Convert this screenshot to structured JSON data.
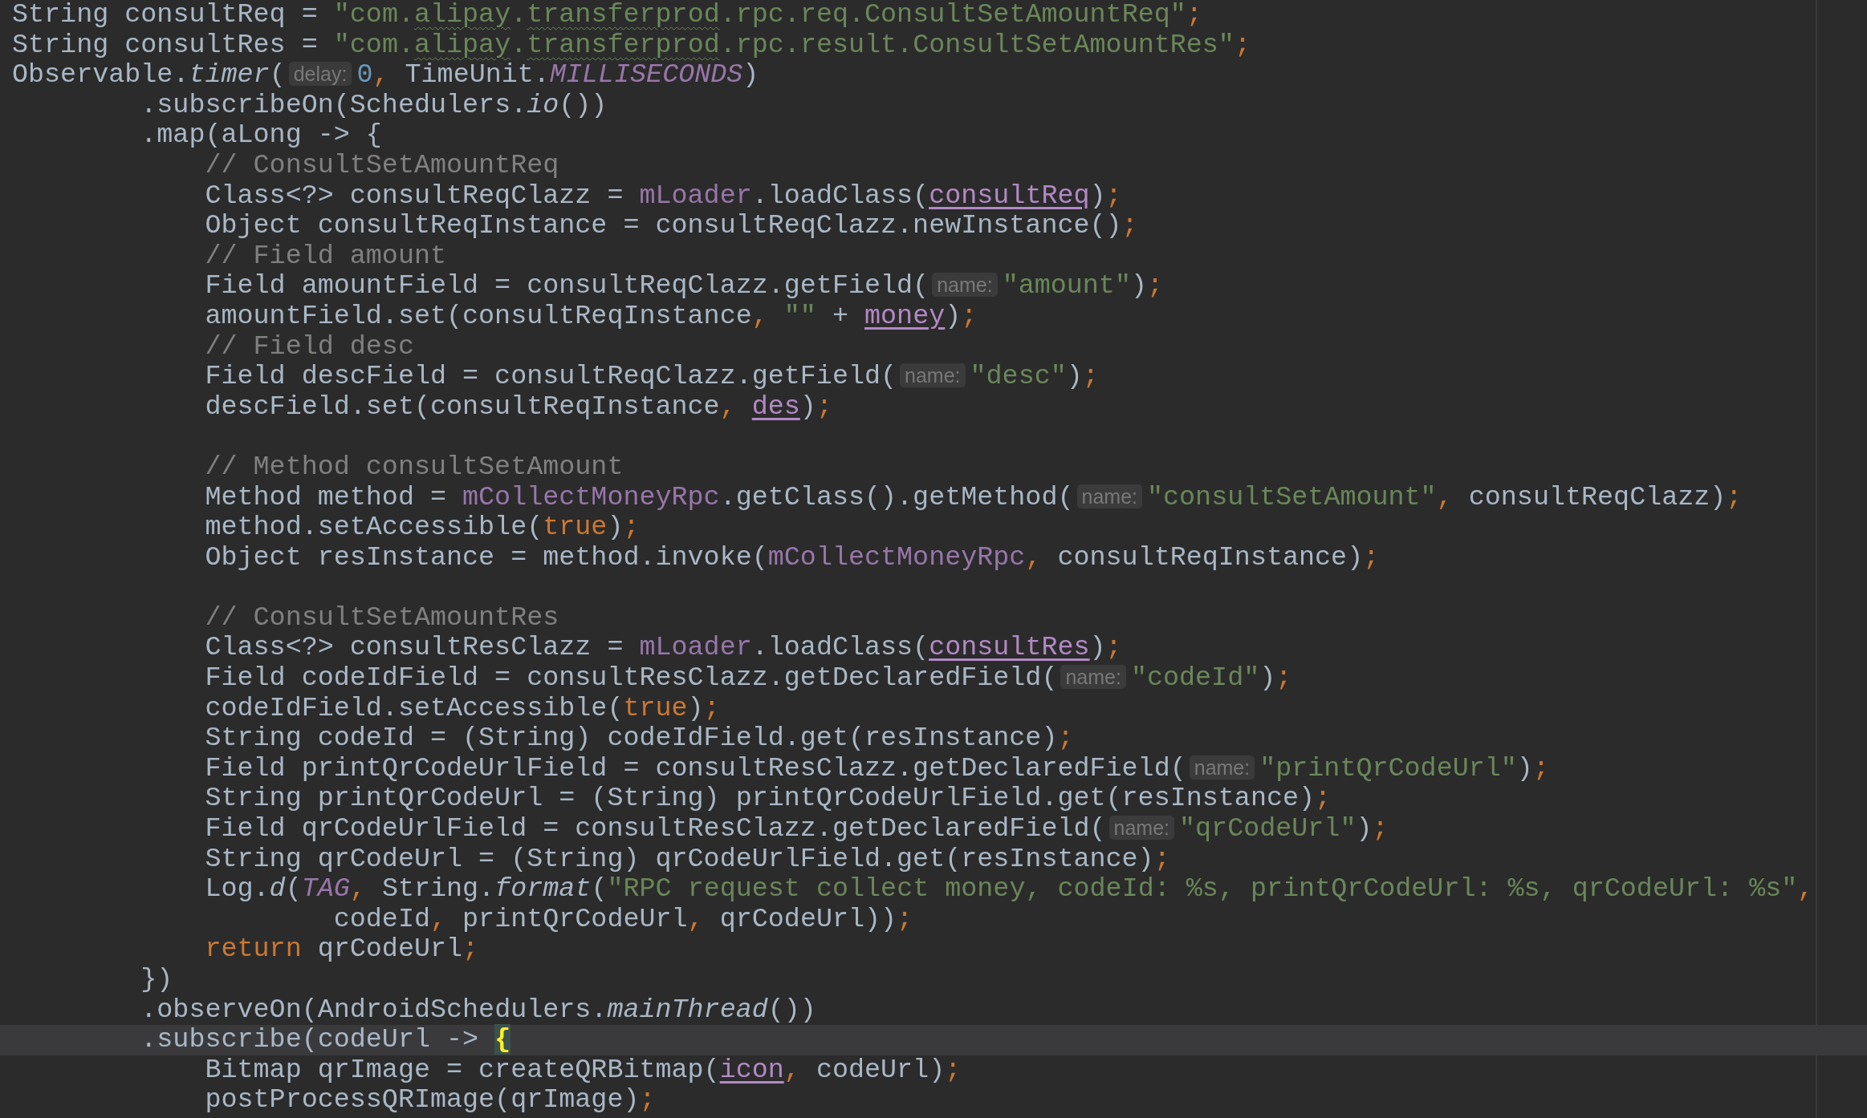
{
  "editor": {
    "lines": [
      {
        "kind": "statement",
        "current": false,
        "tokens": [
          {
            "kind": "plain",
            "text": "String consultReq = "
          },
          {
            "kind": "string",
            "text": "\"com."
          },
          {
            "kind": "typo",
            "text": "alipay"
          },
          {
            "kind": "string",
            "text": "."
          },
          {
            "kind": "typo",
            "text": "transferprod"
          },
          {
            "kind": "string",
            "text": ".rpc.req.ConsultSetAmountReq\""
          },
          {
            "kind": "punct",
            "text": ";"
          }
        ]
      },
      {
        "kind": "statement",
        "current": false,
        "tokens": [
          {
            "kind": "plain",
            "text": "String consultRes = "
          },
          {
            "kind": "string",
            "text": "\"com."
          },
          {
            "kind": "typo",
            "text": "alipay"
          },
          {
            "kind": "string",
            "text": "."
          },
          {
            "kind": "typo",
            "text": "transferprod"
          },
          {
            "kind": "string",
            "text": ".rpc.result.ConsultSetAmountRes\""
          },
          {
            "kind": "punct",
            "text": ";"
          }
        ]
      },
      {
        "kind": "statement",
        "current": false,
        "tokens": [
          {
            "kind": "plain",
            "text": "Observable."
          },
          {
            "kind": "static_method",
            "text": "timer"
          },
          {
            "kind": "plain",
            "text": "("
          },
          {
            "kind": "hint",
            "text": "delay:"
          },
          {
            "kind": "number",
            "text": "0"
          },
          {
            "kind": "punct",
            "text": ","
          },
          {
            "kind": "plain",
            "text": " TimeUnit."
          },
          {
            "kind": "static_field",
            "text": "MILLISECONDS"
          },
          {
            "kind": "plain",
            "text": ")"
          }
        ],
        "children": [
          {
            "kind": "continuation",
            "current": false,
            "tokens": [
              {
                "kind": "plain",
                "text": ".subscribeOn(Schedulers."
              },
              {
                "kind": "static_method",
                "text": "io"
              },
              {
                "kind": "plain",
                "text": "())"
              }
            ]
          },
          {
            "kind": "continuation",
            "current": false,
            "tokens": [
              {
                "kind": "plain",
                "text": ".map(aLong -> {"
              }
            ],
            "children": [
              {
                "kind": "statement",
                "current": false,
                "tokens": [
                  {
                    "kind": "comment",
                    "text": "// ConsultSetAmountReq"
                  }
                ]
              },
              {
                "kind": "statement",
                "current": false,
                "tokens": [
                  {
                    "kind": "plain",
                    "text": "Class<?> consultReqClazz = "
                  },
                  {
                    "kind": "field",
                    "text": "mLoader"
                  },
                  {
                    "kind": "plain",
                    "text": ".loadClass("
                  },
                  {
                    "kind": "captured",
                    "text": "consultReq"
                  },
                  {
                    "kind": "plain",
                    "text": ")"
                  },
                  {
                    "kind": "punct",
                    "text": ";"
                  }
                ]
              },
              {
                "kind": "statement",
                "current": false,
                "tokens": [
                  {
                    "kind": "plain",
                    "text": "Object consultReqInstance = consultReqClazz.newInstance()"
                  },
                  {
                    "kind": "punct",
                    "text": ";"
                  }
                ]
              },
              {
                "kind": "statement",
                "current": false,
                "tokens": [
                  {
                    "kind": "comment",
                    "text": "// Field amount"
                  }
                ]
              },
              {
                "kind": "statement",
                "current": false,
                "tokens": [
                  {
                    "kind": "plain",
                    "text": "Field amountField = consultReqClazz.getField("
                  },
                  {
                    "kind": "hint",
                    "text": "name:"
                  },
                  {
                    "kind": "string",
                    "text": "\"amount\""
                  },
                  {
                    "kind": "plain",
                    "text": ")"
                  },
                  {
                    "kind": "punct",
                    "text": ";"
                  }
                ]
              },
              {
                "kind": "statement",
                "current": false,
                "tokens": [
                  {
                    "kind": "plain",
                    "text": "amountField.set(consultReqInstance"
                  },
                  {
                    "kind": "punct",
                    "text": ","
                  },
                  {
                    "kind": "string",
                    "text": " \"\""
                  },
                  {
                    "kind": "plain",
                    "text": " + "
                  },
                  {
                    "kind": "captured",
                    "text": "money"
                  },
                  {
                    "kind": "plain",
                    "text": ")"
                  },
                  {
                    "kind": "punct",
                    "text": ";"
                  }
                ]
              },
              {
                "kind": "statement",
                "current": false,
                "tokens": [
                  {
                    "kind": "comment",
                    "text": "// Field desc"
                  }
                ]
              },
              {
                "kind": "statement",
                "current": false,
                "tokens": [
                  {
                    "kind": "plain",
                    "text": "Field descField = consultReqClazz.getField("
                  },
                  {
                    "kind": "hint",
                    "text": "name:"
                  },
                  {
                    "kind": "string",
                    "text": "\"desc\""
                  },
                  {
                    "kind": "plain",
                    "text": ")"
                  },
                  {
                    "kind": "punct",
                    "text": ";"
                  }
                ]
              },
              {
                "kind": "statement",
                "current": false,
                "tokens": [
                  {
                    "kind": "plain",
                    "text": "descField.set(consultReqInstance"
                  },
                  {
                    "kind": "punct",
                    "text": ", "
                  },
                  {
                    "kind": "captured",
                    "text": "des"
                  },
                  {
                    "kind": "plain",
                    "text": ")"
                  },
                  {
                    "kind": "punct",
                    "text": ";"
                  }
                ]
              },
              {
                "kind": "statement",
                "current": false
              },
              {
                "kind": "statement",
                "current": false,
                "tokens": [
                  {
                    "kind": "comment",
                    "text": "// Method consultSetAmount"
                  }
                ]
              },
              {
                "kind": "statement",
                "current": false,
                "tokens": [
                  {
                    "kind": "plain",
                    "text": "Method method = "
                  },
                  {
                    "kind": "field",
                    "text": "mCollectMoneyRpc"
                  },
                  {
                    "kind": "plain",
                    "text": ".getClass().getMethod("
                  },
                  {
                    "kind": "hint",
                    "text": "name:"
                  },
                  {
                    "kind": "string",
                    "text": "\"consultSetAmount\""
                  },
                  {
                    "kind": "punct",
                    "text": ","
                  },
                  {
                    "kind": "plain",
                    "text": " consultReqClazz)"
                  },
                  {
                    "kind": "punct",
                    "text": ";"
                  }
                ]
              },
              {
                "kind": "statement",
                "current": false,
                "tokens": [
                  {
                    "kind": "plain",
                    "text": "method.setAccessible("
                  },
                  {
                    "kind": "keyword",
                    "text": "true"
                  },
                  {
                    "kind": "plain",
                    "text": ")"
                  },
                  {
                    "kind": "punct",
                    "text": ";"
                  }
                ]
              },
              {
                "kind": "statement",
                "current": false,
                "tokens": [
                  {
                    "kind": "plain",
                    "text": "Object resInstance = method.invoke("
                  },
                  {
                    "kind": "field",
                    "text": "mCollectMoneyRpc"
                  },
                  {
                    "kind": "punct",
                    "text": ","
                  },
                  {
                    "kind": "plain",
                    "text": " consultReqInstance)"
                  },
                  {
                    "kind": "punct",
                    "text": ";"
                  }
                ]
              },
              {
                "kind": "statement",
                "current": false
              },
              {
                "kind": "statement",
                "current": false,
                "tokens": [
                  {
                    "kind": "comment",
                    "text": "// ConsultSetAmountRes"
                  }
                ]
              },
              {
                "kind": "statement",
                "current": false,
                "tokens": [
                  {
                    "kind": "plain",
                    "text": "Class<?> consultResClazz = "
                  },
                  {
                    "kind": "field",
                    "text": "mLoader"
                  },
                  {
                    "kind": "plain",
                    "text": ".loadClass("
                  },
                  {
                    "kind": "captured",
                    "text": "consultRes"
                  },
                  {
                    "kind": "plain",
                    "text": ")"
                  },
                  {
                    "kind": "punct",
                    "text": ";"
                  }
                ]
              },
              {
                "kind": "statement",
                "current": false,
                "tokens": [
                  {
                    "kind": "plain",
                    "text": "Field codeIdField = consultResClazz.getDeclaredField("
                  },
                  {
                    "kind": "hint",
                    "text": "name:"
                  },
                  {
                    "kind": "string",
                    "text": "\"codeId\""
                  },
                  {
                    "kind": "plain",
                    "text": ")"
                  },
                  {
                    "kind": "punct",
                    "text": ";"
                  }
                ]
              },
              {
                "kind": "statement",
                "current": false,
                "tokens": [
                  {
                    "kind": "plain",
                    "text": "codeIdField.setAccessible("
                  },
                  {
                    "kind": "keyword",
                    "text": "true"
                  },
                  {
                    "kind": "plain",
                    "text": ")"
                  },
                  {
                    "kind": "punct",
                    "text": ";"
                  }
                ]
              },
              {
                "kind": "statement",
                "current": false,
                "tokens": [
                  {
                    "kind": "plain",
                    "text": "String codeId = (String) codeIdField.get(resInstance)"
                  },
                  {
                    "kind": "punct",
                    "text": ";"
                  }
                ]
              },
              {
                "kind": "statement",
                "current": false,
                "tokens": [
                  {
                    "kind": "plain",
                    "text": "Field printQrCodeUrlField = consultResClazz.getDeclaredField("
                  },
                  {
                    "kind": "hint",
                    "text": "name:"
                  },
                  {
                    "kind": "string",
                    "text": "\"printQrCodeUrl\""
                  },
                  {
                    "kind": "plain",
                    "text": ")"
                  },
                  {
                    "kind": "punct",
                    "text": ";"
                  }
                ]
              },
              {
                "kind": "statement",
                "current": false,
                "tokens": [
                  {
                    "kind": "plain",
                    "text": "String printQrCodeUrl = (String) printQrCodeUrlField.get(resInstance)"
                  },
                  {
                    "kind": "punct",
                    "text": ";"
                  }
                ]
              },
              {
                "kind": "statement",
                "current": false,
                "tokens": [
                  {
                    "kind": "plain",
                    "text": "Field qrCodeUrlField = consultResClazz.getDeclaredField("
                  },
                  {
                    "kind": "hint",
                    "text": "name:"
                  },
                  {
                    "kind": "string",
                    "text": "\"qrCodeUrl\""
                  },
                  {
                    "kind": "plain",
                    "text": ")"
                  },
                  {
                    "kind": "punct",
                    "text": ";"
                  }
                ]
              },
              {
                "kind": "statement",
                "current": false,
                "tokens": [
                  {
                    "kind": "plain",
                    "text": "String qrCodeUrl = (String) qrCodeUrlField.get(resInstance)"
                  },
                  {
                    "kind": "punct",
                    "text": ";"
                  }
                ]
              },
              {
                "kind": "statement",
                "current": false,
                "tokens": [
                  {
                    "kind": "plain",
                    "text": "Log."
                  },
                  {
                    "kind": "static_method",
                    "text": "d"
                  },
                  {
                    "kind": "plain",
                    "text": "("
                  },
                  {
                    "kind": "static_field",
                    "text": "TAG"
                  },
                  {
                    "kind": "punct",
                    "text": ","
                  },
                  {
                    "kind": "plain",
                    "text": " String."
                  },
                  {
                    "kind": "static_method",
                    "text": "format"
                  },
                  {
                    "kind": "plain",
                    "text": "("
                  },
                  {
                    "kind": "string",
                    "text": "\"RPC request collect money, codeId: %s, printQrCodeUrl: %s, qrCodeUrl: %s\""
                  },
                  {
                    "kind": "punct",
                    "text": ","
                  }
                ],
                "children": [
                  {
                    "kind": "continuation",
                    "current": false,
                    "tokens": [
                      {
                        "kind": "plain",
                        "text": "codeId"
                      },
                      {
                        "kind": "punct",
                        "text": ","
                      },
                      {
                        "kind": "plain",
                        "text": " printQrCodeUrl"
                      },
                      {
                        "kind": "punct",
                        "text": ","
                      },
                      {
                        "kind": "plain",
                        "text": " qrCodeUrl))"
                      },
                      {
                        "kind": "punct",
                        "text": ";"
                      }
                    ]
                  }
                ]
              },
              {
                "kind": "statement",
                "current": false,
                "tokens": [
                  {
                    "kind": "keyword",
                    "text": "return"
                  },
                  {
                    "kind": "plain",
                    "text": " qrCodeUrl"
                  },
                  {
                    "kind": "punct",
                    "text": ";"
                  }
                ]
              }
            ]
          },
          {
            "kind": "continuation",
            "current": false,
            "tokens": [
              {
                "kind": "plain",
                "text": "})"
              }
            ]
          },
          {
            "kind": "continuation",
            "current": false,
            "tokens": [
              {
                "kind": "plain",
                "text": ".observeOn(AndroidSchedulers."
              },
              {
                "kind": "static_method",
                "text": "mainThread"
              },
              {
                "kind": "plain",
                "text": "())"
              }
            ]
          },
          {
            "kind": "continuation",
            "current": true,
            "tokens": [
              {
                "kind": "plain",
                "text": ".subscribe(codeUrl -> "
              },
              {
                "kind": "brace_match",
                "text": "{"
              }
            ],
            "children": [
              {
                "kind": "statement",
                "current": false,
                "tokens": [
                  {
                    "kind": "plain",
                    "text": "Bitmap qrImage = createQRBitmap("
                  },
                  {
                    "kind": "captured",
                    "text": "icon"
                  },
                  {
                    "kind": "punct",
                    "text": ","
                  },
                  {
                    "kind": "plain",
                    "text": " codeUrl)"
                  },
                  {
                    "kind": "punct",
                    "text": ";"
                  }
                ]
              },
              {
                "kind": "statement",
                "current": false,
                "tokens": [
                  {
                    "kind": "plain",
                    "text": "postProcessQRImage(qrImage)"
                  },
                  {
                    "kind": "punct",
                    "text": ";"
                  }
                ]
              }
            ]
          }
        ]
      }
    ]
  }
}
